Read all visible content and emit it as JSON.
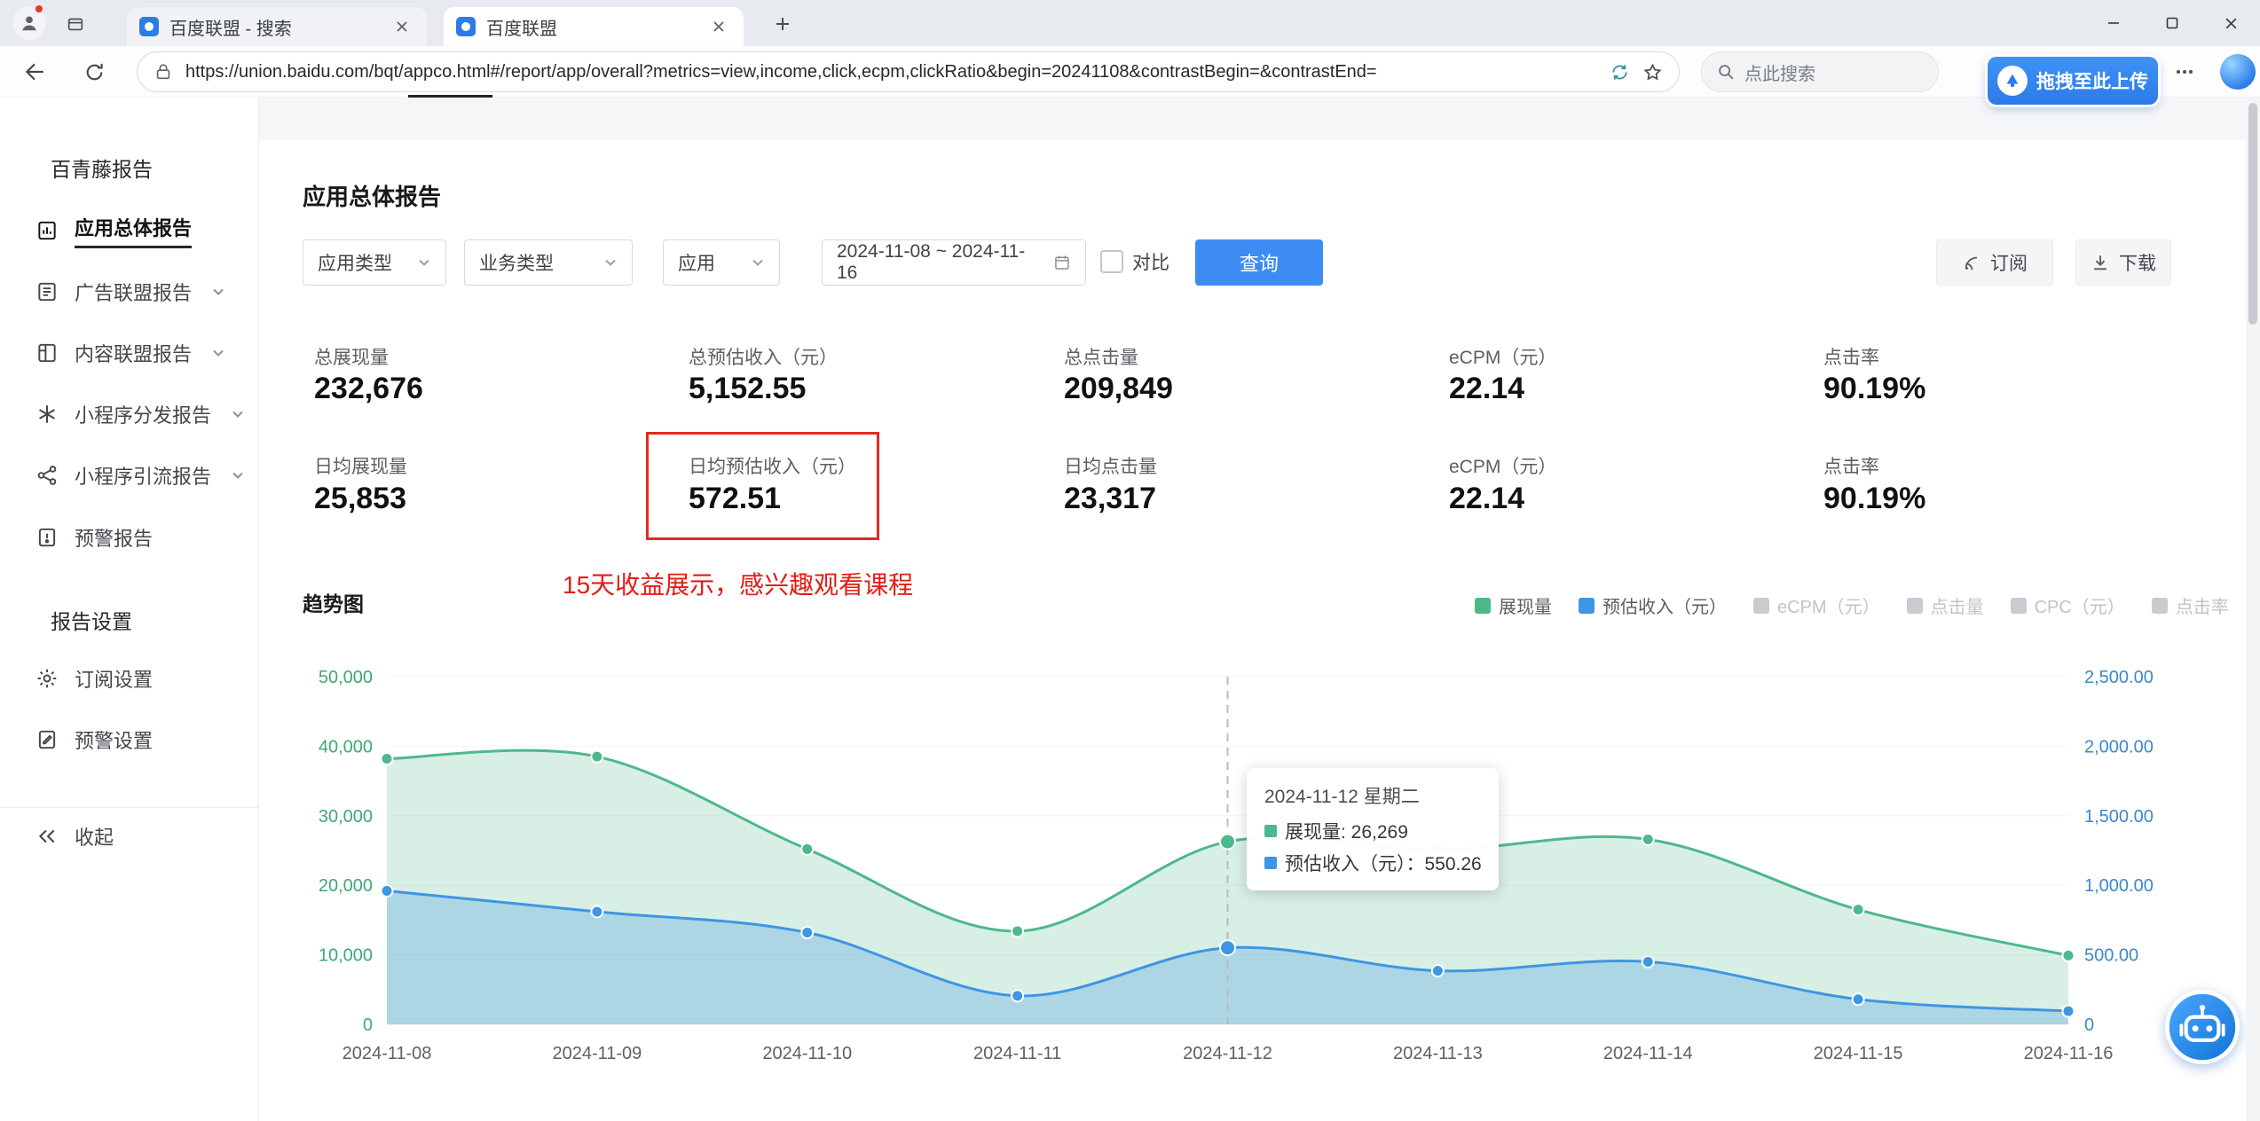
{
  "browser": {
    "tabs": [
      {
        "title": "百度联盟 - 搜索"
      },
      {
        "title": "百度联盟"
      }
    ],
    "url": "https://union.baidu.com/bqt/appco.html#/report/app/overall?metrics=view,income,click,ecpm,clickRatio&begin=20241108&contrastBegin=&contrastEnd=",
    "search_placeholder": "点此搜索",
    "upload_label": "拖拽至此上传"
  },
  "sidebar": {
    "report_section": "百青藤报告",
    "items": [
      {
        "label": "应用总体报告"
      },
      {
        "label": "广告联盟报告"
      },
      {
        "label": "内容联盟报告"
      },
      {
        "label": "小程序分发报告"
      },
      {
        "label": "小程序引流报告"
      },
      {
        "label": "预警报告"
      }
    ],
    "settings_section": "报告设置",
    "settings_items": [
      {
        "label": "订阅设置"
      },
      {
        "label": "预警设置"
      }
    ],
    "collapse_label": "收起"
  },
  "main": {
    "title": "应用总体报告",
    "filters": {
      "app_type": "应用类型",
      "business_type": "业务类型",
      "app": "应用",
      "date_range": "2024-11-08 ~ 2024-11-16",
      "compare_label": "对比",
      "query_label": "查询",
      "subscribe_label": "订阅",
      "download_label": "下载"
    },
    "stats_row1": [
      {
        "label": "总展现量",
        "value": "232,676"
      },
      {
        "label": "总预估收入（元）",
        "value": "5,152.55"
      },
      {
        "label": "总点击量",
        "value": "209,849"
      },
      {
        "label": "eCPM（元）",
        "value": "22.14"
      },
      {
        "label": "点击率",
        "value": "90.19%"
      }
    ],
    "stats_row2": [
      {
        "label": "日均展现量",
        "value": "25,853"
      },
      {
        "label": "日均预估收入（元）",
        "value": "572.51"
      },
      {
        "label": "日均点击量",
        "value": "23,317"
      },
      {
        "label": "eCPM（元）",
        "value": "22.14"
      },
      {
        "label": "点击率",
        "value": "90.19%"
      }
    ],
    "annotation": "15天收益展示，感兴趣观看课程",
    "chart_title": "趋势图",
    "legend": [
      {
        "label": "展现量",
        "color": "#4db88c",
        "active": true
      },
      {
        "label": "预估收入（元）",
        "color": "#3e96e2",
        "active": true
      },
      {
        "label": "eCPM（元）",
        "color": "#c8cbd0",
        "active": false
      },
      {
        "label": "点击量",
        "color": "#c8cbd0",
        "active": false
      },
      {
        "label": "CPC（元）",
        "color": "#c8cbd0",
        "active": false
      },
      {
        "label": "点击率",
        "color": "#c8cbd0",
        "active": false
      }
    ],
    "tooltip": {
      "title": "2024-11-12 星期二",
      "rows": [
        {
          "color": "#4db88c",
          "text": "展现量: 26,269"
        },
        {
          "color": "#3e96e2",
          "text": "预估收入（元）：550.26"
        }
      ]
    }
  },
  "chart_data": {
    "type": "area",
    "title": "趋势图",
    "x": [
      "2024-11-08",
      "2024-11-09",
      "2024-11-10",
      "2024-11-11",
      "2024-11-12",
      "2024-11-13",
      "2024-11-14",
      "2024-11-15",
      "2024-11-16"
    ],
    "series": [
      {
        "name": "展现量",
        "axis": "left",
        "color": "#4db88c",
        "fill": "rgba(77,184,140,0.22)",
        "values": [
          38200,
          38500,
          25200,
          13400,
          26269,
          25100,
          26600,
          16500,
          9900
        ]
      },
      {
        "name": "预估收入（元）",
        "axis": "right",
        "color": "#3e96e2",
        "fill": "rgba(62,150,226,0.28)",
        "values": [
          960,
          810,
          660,
          205,
          550.26,
          385,
          450,
          180,
          95
        ]
      }
    ],
    "left_axis": {
      "min": 0,
      "max": 50000,
      "ticks": [
        "0",
        "10,000",
        "20,000",
        "30,000",
        "40,000",
        "50,000"
      ],
      "color": "#3fa874"
    },
    "right_axis": {
      "min": 0,
      "max": 2500,
      "ticks": [
        "0",
        "500.00",
        "1,000.00",
        "1,500.00",
        "2,000.00",
        "2,500.00"
      ],
      "color": "#3c88cf"
    },
    "highlight_index": 4,
    "legend_position": "top-right",
    "grid": false
  }
}
